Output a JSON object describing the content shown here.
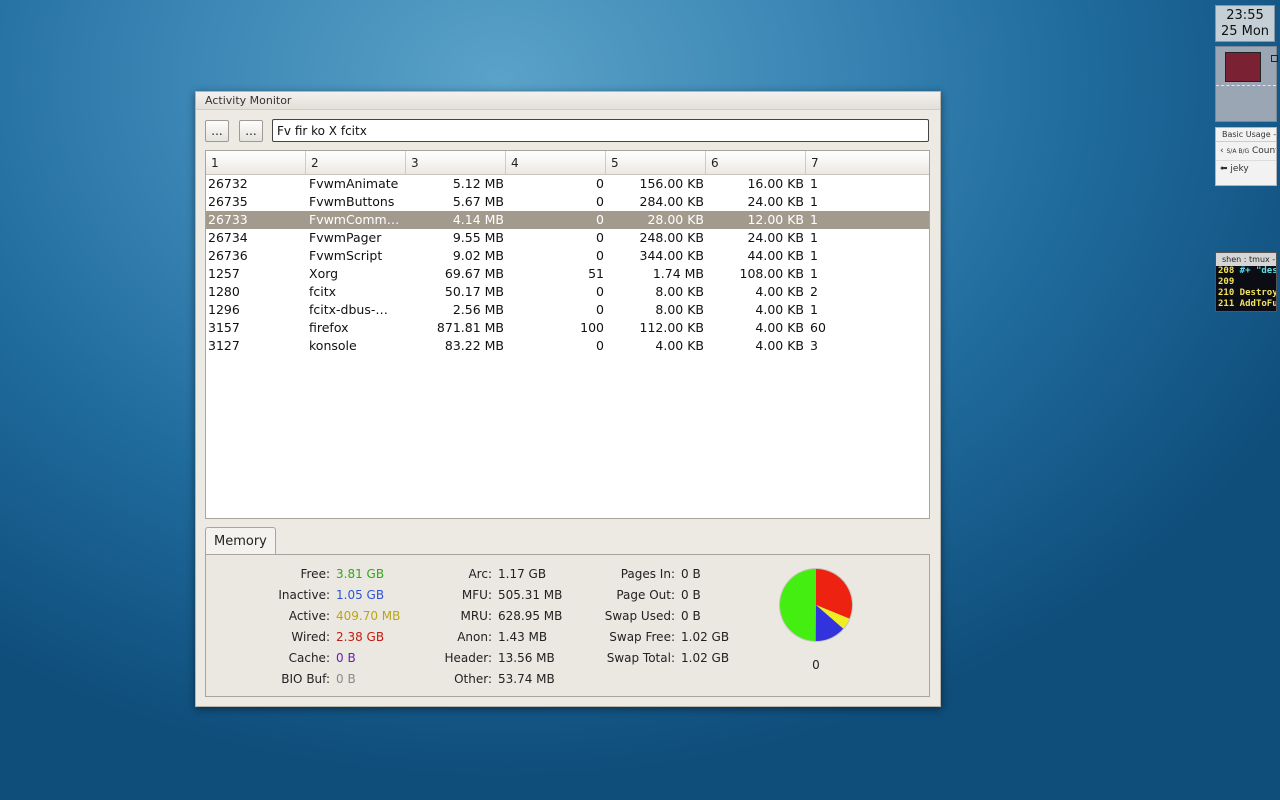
{
  "window": {
    "title": "Activity Monitor"
  },
  "toolbar": {
    "btn1": "...",
    "btn2": "...",
    "search_value": "Fv fir ko X fcitx"
  },
  "table": {
    "columns": [
      "1",
      "2",
      "3",
      "4",
      "5",
      "6",
      "7"
    ],
    "selected_index": 2,
    "rows": [
      [
        "26732",
        "FvwmAnimate",
        "5.12 MB",
        "0",
        "156.00 KB",
        "16.00 KB",
        "1"
      ],
      [
        "26735",
        "FvwmButtons",
        "5.67 MB",
        "0",
        "284.00 KB",
        "24.00 KB",
        "1"
      ],
      [
        "26733",
        "FvwmComm…",
        "4.14 MB",
        "0",
        "28.00 KB",
        "12.00 KB",
        "1"
      ],
      [
        "26734",
        "FvwmPager",
        "9.55 MB",
        "0",
        "248.00 KB",
        "24.00 KB",
        "1"
      ],
      [
        "26736",
        "FvwmScript",
        "9.02 MB",
        "0",
        "344.00 KB",
        "44.00 KB",
        "1"
      ],
      [
        "1257",
        "Xorg",
        "69.67 MB",
        "51",
        "1.74 MB",
        "108.00 KB",
        "1"
      ],
      [
        "1280",
        "fcitx",
        "50.17 MB",
        "0",
        "8.00 KB",
        "4.00 KB",
        "2"
      ],
      [
        "1296",
        "fcitx-dbus-…",
        "2.56 MB",
        "0",
        "8.00 KB",
        "4.00 KB",
        "1"
      ],
      [
        "3157",
        "firefox",
        "871.81 MB",
        "100",
        "112.00 KB",
        "4.00 KB",
        "60"
      ],
      [
        "3127",
        "konsole",
        "83.22 MB",
        "0",
        "4.00 KB",
        "4.00 KB",
        "3"
      ]
    ]
  },
  "memory": {
    "tab_label": "Memory",
    "col1": [
      {
        "label": "Free:",
        "value": "3.81 GB",
        "color": "#2fa81a"
      },
      {
        "label": "Inactive:",
        "value": "1.05 GB",
        "color": "#2c55d6"
      },
      {
        "label": "Active:",
        "value": "409.70 MB",
        "color": "#b8a617"
      },
      {
        "label": "Wired:",
        "value": "2.38 GB",
        "color": "#c41b12"
      },
      {
        "label": "Cache:",
        "value": "0 B",
        "color": "#6a1fb0"
      },
      {
        "label": "BIO Buf:",
        "value": "0 B",
        "color": "#8a8a8a"
      }
    ],
    "col2": [
      {
        "label": "Arc:",
        "value": "1.17 GB"
      },
      {
        "label": "MFU:",
        "value": "505.31 MB"
      },
      {
        "label": "MRU:",
        "value": "628.95 MB"
      },
      {
        "label": "Anon:",
        "value": "1.43 MB"
      },
      {
        "label": "Header:",
        "value": "13.56 MB"
      },
      {
        "label": "Other:",
        "value": "53.74 MB"
      }
    ],
    "col3": [
      {
        "label": "Pages In:",
        "value": "0 B"
      },
      {
        "label": "Page Out:",
        "value": "0 B"
      },
      {
        "label": "Swap Used:",
        "value": "0 B"
      },
      {
        "label": "Swap Free:",
        "value": "1.02 GB"
      },
      {
        "label": "Swap Total:",
        "value": "1.02 GB"
      }
    ],
    "pie_label": "0",
    "pie_colors": {
      "free": "#44ee11",
      "wired": "#ee2211",
      "active": "#eeee22",
      "inactive": "#3333dd"
    }
  },
  "desktop": {
    "clock_time": "23:55",
    "clock_date": "25 Mon",
    "browser_title": "Basic Usage - V",
    "browser_tab": "Counte",
    "browser_url": "jeky",
    "browser_favicon": "S/A B/G",
    "terminal_title": "shen : tmux -",
    "terminal_lines": [
      {
        "num": "208",
        "text": " #+ \"des"
      },
      {
        "num": "209",
        "text": ""
      },
      {
        "num": "210",
        "text": " Destroy"
      },
      {
        "num": "211",
        "text": " AddToFu"
      }
    ]
  }
}
